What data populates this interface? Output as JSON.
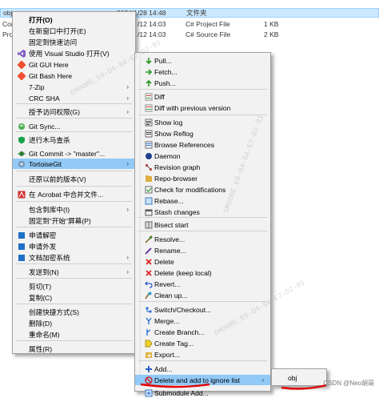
{
  "explorer": {
    "rows": [
      {
        "name": "obj",
        "date": "2024/1/28 14:48",
        "type": "文件夹",
        "size": ""
      },
      {
        "name": "Cor",
        "date": "/12 14:03",
        "type": "C# Project File",
        "size": "1 KB"
      },
      {
        "name": "Pro",
        "date": "/12 14:03",
        "type": "C# Source File",
        "size": "2 KB"
      }
    ]
  },
  "main_menu": {
    "items": [
      {
        "label": "打开(O)",
        "icon": "none",
        "bold": true
      },
      {
        "label": "在新窗口中打开(E)",
        "icon": "none"
      },
      {
        "label": "固定到快速访问",
        "icon": "none"
      },
      {
        "label": "使用 Visual Studio 打开(V)",
        "icon": "visual-studio-icon"
      },
      {
        "label": "Git GUI Here",
        "icon": "git-gui-icon"
      },
      {
        "label": "Git Bash Here",
        "icon": "git-bash-icon"
      },
      {
        "label": "7-Zip",
        "icon": "none",
        "sub": true
      },
      {
        "label": "CRC SHA",
        "icon": "none",
        "sub": true
      },
      {
        "label": "授予访问权限(G)",
        "icon": "none",
        "sub": true
      },
      {
        "label": "Git Sync...",
        "icon": "git-sync-icon"
      },
      {
        "label": "进行木马查杀",
        "icon": "shield-icon"
      },
      {
        "label": "Git Commit -> \"master\"...",
        "icon": "git-commit-icon"
      },
      {
        "label": "TortoiseGit",
        "icon": "tortoisegit-icon",
        "sub": true
      },
      {
        "label": "还原以前的版本(V)",
        "icon": "none"
      },
      {
        "label": "在 Acrobat 中合并文件...",
        "icon": "acrobat-icon"
      },
      {
        "label": "包含到库中(I)",
        "icon": "none",
        "sub": true
      },
      {
        "label": "固定到\"开始\"屏幕(P)",
        "icon": "none"
      },
      {
        "label": "申请解密",
        "icon": "decrypt-icon"
      },
      {
        "label": "申请外发",
        "icon": "send-out-icon"
      },
      {
        "label": "文档加密系统",
        "icon": "doc-encrypt-icon",
        "sub": true
      },
      {
        "label": "发送到(N)",
        "icon": "none",
        "sub": true
      },
      {
        "label": "剪切(T)",
        "icon": "none"
      },
      {
        "label": "复制(C)",
        "icon": "none"
      },
      {
        "label": "创建快捷方式(S)",
        "icon": "none"
      },
      {
        "label": "删除(D)",
        "icon": "none"
      },
      {
        "label": "重命名(M)",
        "icon": "none"
      },
      {
        "label": "属性(R)",
        "icon": "none"
      }
    ]
  },
  "tortoise_menu": {
    "items": [
      {
        "label": "Pull...",
        "icon": "pull-icon"
      },
      {
        "label": "Fetch...",
        "icon": "fetch-icon"
      },
      {
        "label": "Push...",
        "icon": "push-icon"
      },
      {
        "label": "Diff",
        "icon": "diff-icon"
      },
      {
        "label": "Diff with previous version",
        "icon": "diff-previous-icon"
      },
      {
        "label": "Show log",
        "icon": "show-log-icon"
      },
      {
        "label": "Show Reflog",
        "icon": "reflog-icon"
      },
      {
        "label": "Browse References",
        "icon": "browse-references-icon"
      },
      {
        "label": "Daemon",
        "icon": "daemon-icon"
      },
      {
        "label": "Revision graph",
        "icon": "revision-graph-icon"
      },
      {
        "label": "Repo-browser",
        "icon": "repo-browser-icon"
      },
      {
        "label": "Check for modifications",
        "icon": "check-modifications-icon"
      },
      {
        "label": "Rebase...",
        "icon": "rebase-icon"
      },
      {
        "label": "Stash changes",
        "icon": "stash-icon"
      },
      {
        "label": "Bisect start",
        "icon": "bisect-icon"
      },
      {
        "label": "Resolve...",
        "icon": "resolve-icon"
      },
      {
        "label": "Rename...",
        "icon": "rename-icon"
      },
      {
        "label": "Delete",
        "icon": "delete-icon"
      },
      {
        "label": "Delete (keep local)",
        "icon": "delete-keep-local-icon"
      },
      {
        "label": "Revert...",
        "icon": "revert-icon"
      },
      {
        "label": "Clean up...",
        "icon": "clean-up-icon"
      },
      {
        "label": "Switch/Checkout...",
        "icon": "switch-checkout-icon"
      },
      {
        "label": "Merge...",
        "icon": "merge-icon"
      },
      {
        "label": "Create Branch...",
        "icon": "create-branch-icon"
      },
      {
        "label": "Create Tag...",
        "icon": "create-tag-icon"
      },
      {
        "label": "Export...",
        "icon": "export-icon"
      },
      {
        "label": "Add...",
        "icon": "add-icon"
      },
      {
        "label": "Delete and add to ignore list",
        "icon": "ignore-icon",
        "sub": true
      },
      {
        "label": "Submodule Add...",
        "icon": "submodule-add-icon"
      }
    ]
  },
  "ignore_submenu": {
    "items": [
      {
        "label": "obj"
      }
    ]
  },
  "watermarks": [
    "SMOORE_E0-D4-64-E7-D2-81",
    "SMOORE_E0-D4-64-E7-D2-81",
    "SMOORE_E0-D4-64-E7-D2-81"
  ],
  "credit": "CSDN @Neo胡哥",
  "colors": {
    "highlight": "#91c9f7",
    "menu_bg": "#f2f2f2",
    "annotation_red": "#e00000"
  }
}
